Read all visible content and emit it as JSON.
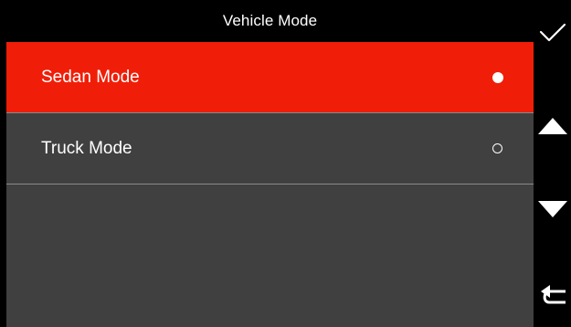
{
  "header": {
    "title": "Vehicle Mode"
  },
  "menu": {
    "items": [
      {
        "label": "Sedan Mode",
        "selected": true
      },
      {
        "label": "Truck Mode",
        "selected": false
      }
    ]
  },
  "side_buttons": [
    {
      "icon": "checkmark-icon"
    },
    {
      "icon": "triangle-up-icon"
    },
    {
      "icon": "triangle-down-icon"
    },
    {
      "icon": "return-arrow-icon"
    }
  ],
  "colors": {
    "selected_bg": "#f01e08",
    "panel_bg": "#404040",
    "chrome_bg": "#000000",
    "text": "#ffffff"
  }
}
